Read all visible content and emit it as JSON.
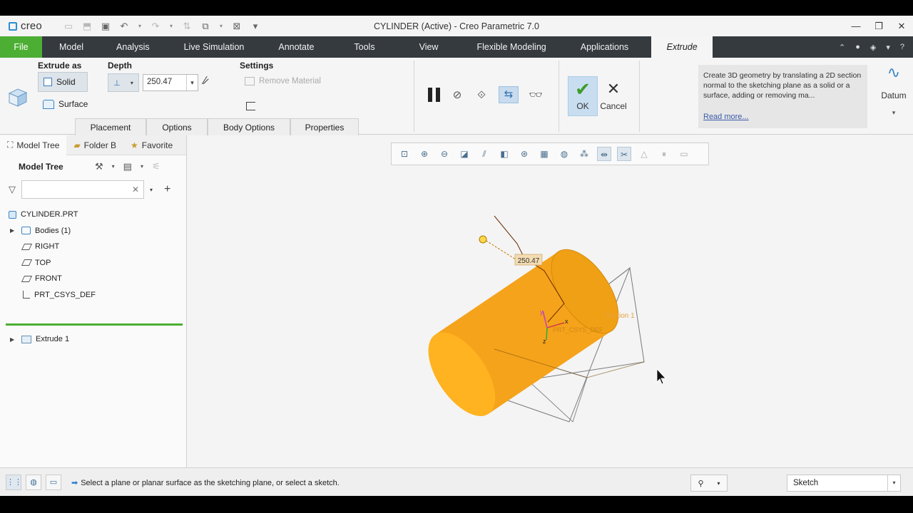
{
  "titlebar": {
    "logo": "creo",
    "title": "CYLINDER (Active) - Creo Parametric 7.0",
    "minimize": "—",
    "restore": "❐",
    "close": "✕"
  },
  "ribbon_tabs": {
    "file": "File",
    "model": "Model",
    "analysis": "Analysis",
    "live_simulation": "Live Simulation",
    "annotate": "Annotate",
    "tools": "Tools",
    "view": "View",
    "flexible_modeling": "Flexible Modeling",
    "applications": "Applications",
    "extrude": "Extrude"
  },
  "ribbon": {
    "extrude_as_label": "Extrude as",
    "solid_label": "Solid",
    "surface_label": "Surface",
    "depth_label": "Depth",
    "depth_value": "250.47",
    "settings_label": "Settings",
    "remove_material_label": "Remove Material",
    "subtabs": {
      "placement": "Placement",
      "options": "Options",
      "body_options": "Body Options",
      "properties": "Properties"
    },
    "ok_label": "OK",
    "cancel_label": "Cancel",
    "help_text": "Create 3D geometry by translating a 2D section normal to the sketching plane as a solid or a surface, adding or removing ma...",
    "read_more": "Read more...",
    "datum_label": "Datum"
  },
  "navigator": {
    "tabs": {
      "model_tree": "Model Tree",
      "folder_browser": "Folder B",
      "favorites": "Favorite"
    },
    "header": "Model Tree",
    "filter_placeholder": "",
    "tree": {
      "part": "CYLINDER.PRT",
      "bodies": "Bodies (1)",
      "right": "RIGHT",
      "top": "TOP",
      "front": "FRONT",
      "csys": "PRT_CSYS_DEF",
      "extrude": "Extrude 1"
    }
  },
  "viewport": {
    "dimension_label": "250.47",
    "section_label": "Section 1",
    "csys_label": "PRT_CSYS_DEF",
    "axis_x": "x",
    "axis_y": "y",
    "axis_z": "z",
    "cylinder_color": "#f5a31a"
  },
  "statusbar": {
    "message": "Select a plane or planar surface as the sketching plane, or select a sketch.",
    "filter_value": "Sketch"
  }
}
